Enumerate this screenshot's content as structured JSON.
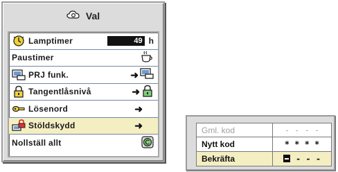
{
  "menu": {
    "title": "Val",
    "title_icon": "gear-cloud-icon",
    "items": [
      {
        "label": "Lamptimer",
        "icon": "clock-icon",
        "value": "49",
        "unit": "h"
      },
      {
        "label": "Paustimer",
        "icon": "coffee-cup-icon"
      },
      {
        "label": "PRJ funk.",
        "icon": "projector-screen-icon",
        "arrow": "➜"
      },
      {
        "label": "Tangentlåsnivå",
        "icon": "padlock-icon",
        "arrow": "➜"
      },
      {
        "label": "Lösenord",
        "icon": "key-icon",
        "arrow": "➜"
      },
      {
        "label": "Stöldskydd",
        "icon": "anti-theft-icon",
        "arrow": "➜",
        "selected": true
      },
      {
        "label": "Nollställ allt",
        "icon": "reset-icon"
      }
    ]
  },
  "password_panel": {
    "rows": [
      {
        "label": "Gml. kod",
        "value": "- - - -",
        "disabled": true
      },
      {
        "label": "Nytt kod",
        "value": "* * * *"
      },
      {
        "label": "Bekräfta",
        "value": "- - -",
        "selected": true
      }
    ]
  },
  "colors": {
    "panel_bg": "#dcdcdc",
    "selected_bg": "#f4eec3",
    "row_divider": "#6f8aa6"
  }
}
